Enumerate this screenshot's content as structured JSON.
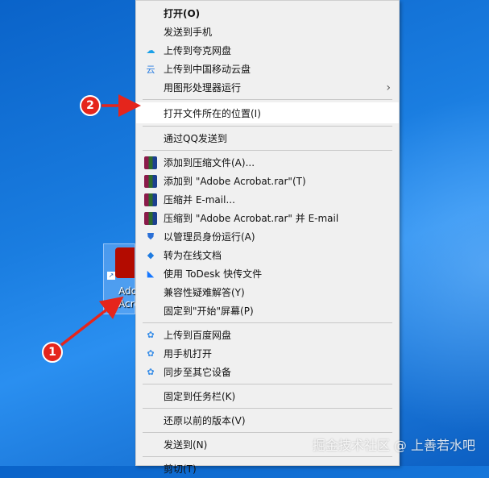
{
  "desktop_icon": {
    "label_line1": "Ado",
    "label_line2": "Acro"
  },
  "annotations": {
    "step1": "1",
    "step2": "2"
  },
  "watermark": "掘金技术社区 @ 上善若水吧",
  "menu": {
    "items": [
      {
        "label": "打开(O)",
        "icon": "none",
        "bold": true
      },
      {
        "label": "发送到手机",
        "icon": "none"
      },
      {
        "label": "上传到夸克网盘",
        "icon": "quark-cloud-icon"
      },
      {
        "label": "上传到中国移动云盘",
        "icon": "mobile-cloud-icon"
      },
      {
        "label": "用图形处理器运行",
        "icon": "none",
        "submenu": true
      },
      {
        "sep": true
      },
      {
        "label": "打开文件所在的位置(I)",
        "icon": "none",
        "highlighted": true
      },
      {
        "sep": true
      },
      {
        "label": "通过QQ发送到",
        "icon": "none"
      },
      {
        "sep": true
      },
      {
        "label": "添加到压缩文件(A)...",
        "icon": "winrar-icon"
      },
      {
        "label": "添加到 \"Adobe Acrobat.rar\"(T)",
        "icon": "winrar-icon"
      },
      {
        "label": "压缩并 E-mail...",
        "icon": "winrar-icon"
      },
      {
        "label": "压缩到 \"Adobe Acrobat.rar\" 并 E-mail",
        "icon": "winrar-icon"
      },
      {
        "label": "以管理员身份运行(A)",
        "icon": "uac-shield-icon"
      },
      {
        "label": "转为在线文档",
        "icon": "online-doc-icon"
      },
      {
        "label": "使用 ToDesk 快传文件",
        "icon": "todesk-icon"
      },
      {
        "label": "兼容性疑难解答(Y)",
        "icon": "none"
      },
      {
        "label": "固定到\"开始\"屏幕(P)",
        "icon": "none"
      },
      {
        "sep": true
      },
      {
        "label": "上传到百度网盘",
        "icon": "baidu-netdisk-icon"
      },
      {
        "label": "用手机打开",
        "icon": "baidu-netdisk-icon"
      },
      {
        "label": "同步至其它设备",
        "icon": "baidu-netdisk-icon"
      },
      {
        "sep": true
      },
      {
        "label": "固定到任务栏(K)",
        "icon": "none"
      },
      {
        "sep": true
      },
      {
        "label": "还原以前的版本(V)",
        "icon": "none"
      },
      {
        "sep": true
      },
      {
        "label": "发送到(N)",
        "icon": "none"
      },
      {
        "sep": true
      },
      {
        "label": "剪切(T)",
        "icon": "none"
      }
    ],
    "submenu_glyph": "›"
  }
}
